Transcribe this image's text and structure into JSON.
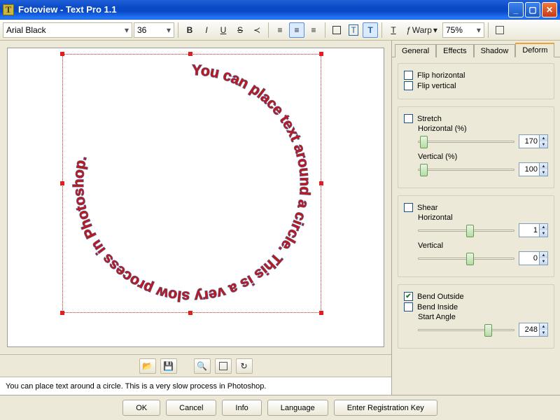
{
  "window": {
    "title": "Fotoview - Text Pro 1.1"
  },
  "toolbar": {
    "font": "Arial Black",
    "size": "36",
    "warp_label": "Warp",
    "zoom": "75%"
  },
  "text_input": "You can place text around a circle. This is a very slow process in Photoshop.",
  "circle_text": "You can place text around a circle. This is a very slow process in Photoshop.",
  "tabs": {
    "general": "General",
    "effects": "Effects",
    "shadow": "Shadow",
    "deform": "Deform"
  },
  "deform": {
    "flip_h": "Flip horizontal",
    "flip_v": "Flip vertical",
    "stretch": "Stretch",
    "stretch_h_label": "Horizontal (%)",
    "stretch_h": "170",
    "stretch_v_label": "Vertical (%)",
    "stretch_v": "100",
    "shear": "Shear",
    "shear_h_label": "Horizontal",
    "shear_h": "1",
    "shear_v_label": "Vertical",
    "shear_v": "0",
    "bend_out": "Bend Outside",
    "bend_in": "Bend Inside",
    "start_angle_label": "Start Angle",
    "start_angle": "248"
  },
  "buttons": {
    "ok": "OK",
    "cancel": "Cancel",
    "info": "Info",
    "language": "Language",
    "register": "Enter Registration Key"
  }
}
